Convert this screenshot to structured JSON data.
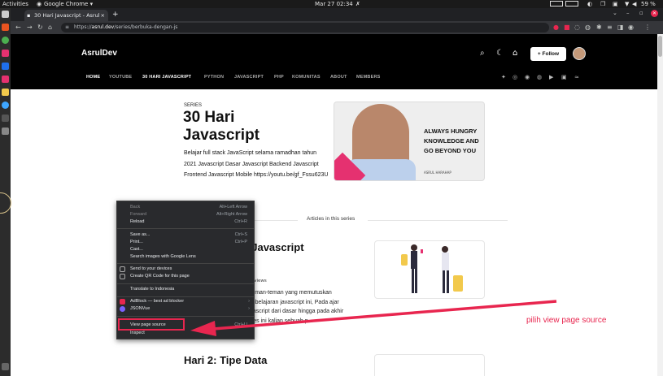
{
  "system_bar": {
    "activities": "Activities",
    "app": "Google Chrome ▾",
    "datetime": "Mar 27  02:34",
    "battery": "59 %"
  },
  "browser": {
    "tab_title": "30 Hari Javascript - Asrul",
    "tab_close": "×",
    "new_tab": "+",
    "url_host": "asrul.dev",
    "url_prefix": "https://",
    "url_path": "/series/berbuka-dengan-js"
  },
  "site": {
    "brand": "AsrulDev",
    "follow_label": "+ Follow",
    "menu": [
      "HOME",
      "YOUTUBE",
      "30 HARI JAVASCRIPT",
      "PYTHON",
      "JAVASCRIPT",
      "PHP",
      "KOMUNITAS",
      "ABOUT",
      "MEMBERS"
    ],
    "active_menu": "30 HARI JAVASCRIPT"
  },
  "series": {
    "label": "SERIES",
    "title": "30 Hari Javascript",
    "description": "Belajar full stack JavaScript selama ramadhan tahun 2021 Javascript Dasar Javascript Backend Javascript Frontend Javascript Mobile https://youtu.be/gf_Fssu623U"
  },
  "cover": {
    "quote": "ALWAYS HUNGRY KNOWLEDGE AND GO BEYOND YOU",
    "caption": "ASRUL HARAHAP"
  },
  "articles_section": {
    "label": "Articles in this series"
  },
  "article1": {
    "title": "tar Javascript",
    "views": "278 views",
    "excerpt": "gi teman-teman yang memutuskan pembelajaran javascript ini, Pada ajar Javascript dari dasar hingga pada akhir series ini kalian sebuah p..."
  },
  "article2": {
    "title": "Hari 2: Tipe Data"
  },
  "context_menu": {
    "back": "Back",
    "back_sc": "Alt+Left Arrow",
    "forward": "Forward",
    "forward_sc": "Alt+Right Arrow",
    "reload": "Reload",
    "reload_sc": "Ctrl+R",
    "save_as": "Save as...",
    "save_as_sc": "Ctrl+S",
    "print": "Print...",
    "print_sc": "Ctrl+P",
    "cast": "Cast...",
    "search_images": "Search images with Google Lens",
    "send_devices": "Send to your devices",
    "qr_code": "Create QR Code for this page",
    "translate": "Translate to Indonesia",
    "adblock": "AdBlock — best ad blocker",
    "jsonvue": "JSONVue",
    "view_source": "View page source",
    "view_source_sc": "Ctrl+U",
    "inspect": "Inspect"
  },
  "annotation": {
    "text": "pilih view page source",
    "color": "#e8264f"
  }
}
